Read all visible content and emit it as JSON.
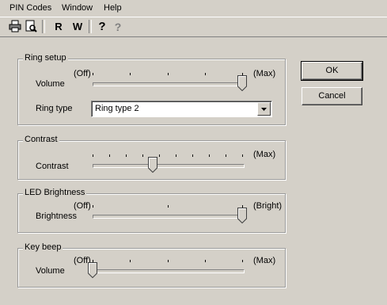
{
  "menu": [
    "PIN Codes",
    "Window",
    "Help"
  ],
  "toolbar": {
    "r_label": "R",
    "w_label": "W",
    "help_label": "?",
    "whatsthis_label": "?"
  },
  "ring_setup": {
    "title": "Ring setup",
    "min_label": "(Off)",
    "max_label": "(Max)",
    "volume_label": "Volume",
    "volume_level": 1.0,
    "ring_type_label": "Ring type",
    "ring_type_value": "Ring type 2"
  },
  "contrast": {
    "title": "Contrast",
    "max_label": "(Max)",
    "slider_label": "Contrast",
    "level": 0.4
  },
  "led": {
    "title": "LED Brightness",
    "min_label": "(Off)",
    "max_label": "(Bright)",
    "slider_label": "Brightness",
    "level": 1.0
  },
  "key_beep": {
    "title": "Key beep",
    "min_label": "(Off)",
    "max_label": "(Max)",
    "volume_label": "Volume",
    "level": 0.0
  },
  "buttons": {
    "ok": "OK",
    "cancel": "Cancel"
  }
}
